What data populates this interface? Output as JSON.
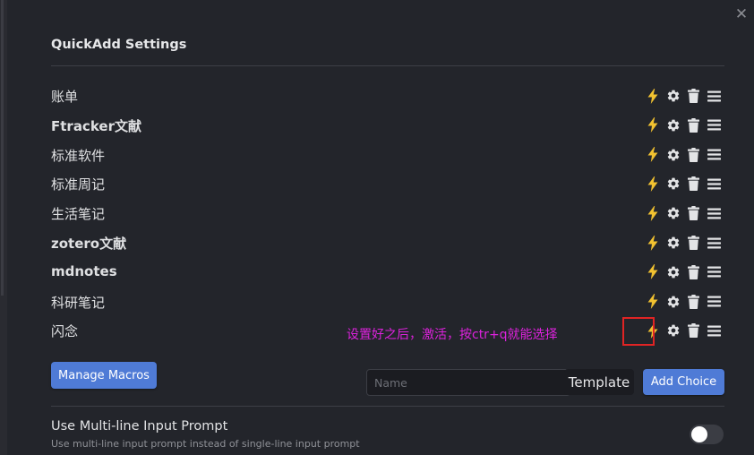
{
  "modal": {
    "title": "QuickAdd Settings",
    "close_glyph": "✕"
  },
  "choices": [
    {
      "label": "账单"
    },
    {
      "label": "Ftracker文献"
    },
    {
      "label": "标准软件"
    },
    {
      "label": "标准周记"
    },
    {
      "label": "生活笔记"
    },
    {
      "label": "zotero文献"
    },
    {
      "label": "mdnotes"
    },
    {
      "label": "科研笔记"
    },
    {
      "label": "闪念"
    }
  ],
  "choice_actions": [
    "lightning-icon",
    "gear-icon",
    "trash-icon",
    "drag-handle-icon"
  ],
  "annotation": {
    "text": "设置好之后，激活，按ctr+q就能选择"
  },
  "buttons": {
    "manage_macros": "Manage Macros",
    "template": "Template",
    "add_choice": "Add Choice"
  },
  "name_input": {
    "placeholder": "Name",
    "value": ""
  },
  "setting": {
    "name": "Use Multi-line Input Prompt",
    "description": "Use multi-line input prompt instead of single-line input prompt",
    "enabled": false
  },
  "colors": {
    "background": "#23252b",
    "accent": "#4f7bd6",
    "lightning": "#f2c230",
    "annotation": "#dd22dd",
    "highlight": "#e02424"
  }
}
